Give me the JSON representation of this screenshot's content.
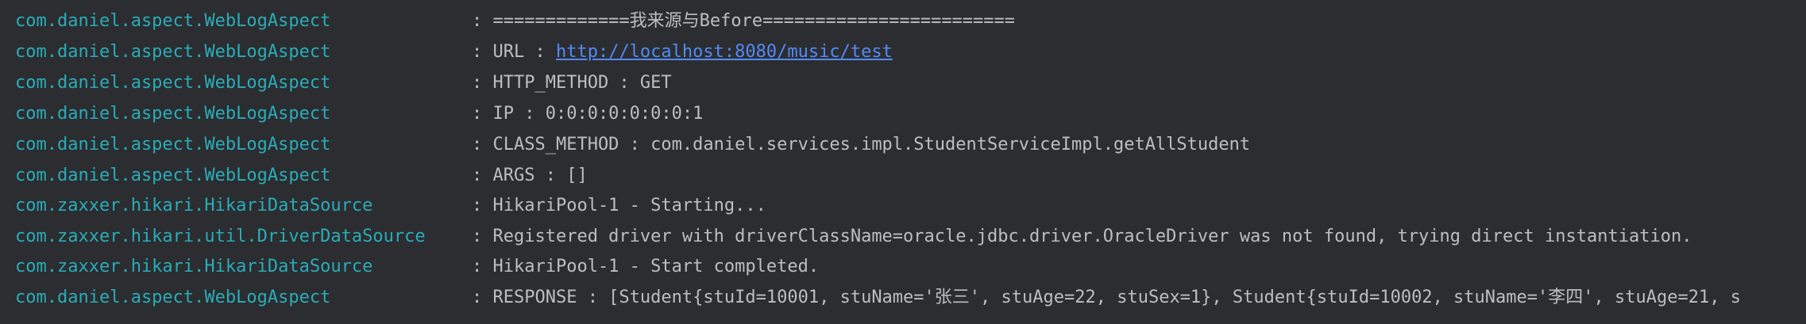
{
  "colors": {
    "background": "#2b2d30",
    "logger": "#2aacb8",
    "message": "#bcbec4",
    "link": "#548af7"
  },
  "lines": [
    {
      "logger": "com.daniel.aspect.WebLogAspect",
      "prefix": ": =============我来源与Before========================",
      "link": "",
      "suffix": ""
    },
    {
      "logger": "com.daniel.aspect.WebLogAspect",
      "prefix": ": URL : ",
      "link": "http://localhost:8080/music/test",
      "suffix": ""
    },
    {
      "logger": "com.daniel.aspect.WebLogAspect",
      "prefix": ": HTTP_METHOD : GET",
      "link": "",
      "suffix": ""
    },
    {
      "logger": "com.daniel.aspect.WebLogAspect",
      "prefix": ": IP : 0:0:0:0:0:0:0:1",
      "link": "",
      "suffix": ""
    },
    {
      "logger": "com.daniel.aspect.WebLogAspect",
      "prefix": ": CLASS_METHOD : com.daniel.services.impl.StudentServiceImpl.getAllStudent",
      "link": "",
      "suffix": ""
    },
    {
      "logger": "com.daniel.aspect.WebLogAspect",
      "prefix": ": ARGS : []",
      "link": "",
      "suffix": ""
    },
    {
      "logger": "com.zaxxer.hikari.HikariDataSource",
      "prefix": ": HikariPool-1 - Starting...",
      "link": "",
      "suffix": ""
    },
    {
      "logger": "com.zaxxer.hikari.util.DriverDataSource",
      "prefix": ": Registered driver with driverClassName=oracle.jdbc.driver.OracleDriver was not found, trying direct instantiation.",
      "link": "",
      "suffix": ""
    },
    {
      "logger": "com.zaxxer.hikari.HikariDataSource",
      "prefix": ": HikariPool-1 - Start completed.",
      "link": "",
      "suffix": ""
    },
    {
      "logger": "com.daniel.aspect.WebLogAspect",
      "prefix": ": RESPONSE : [Student{stuId=10001, stuName='张三', stuAge=22, stuSex=1}, Student{stuId=10002, stuName='李四', stuAge=21, s",
      "link": "",
      "suffix": ""
    }
  ]
}
